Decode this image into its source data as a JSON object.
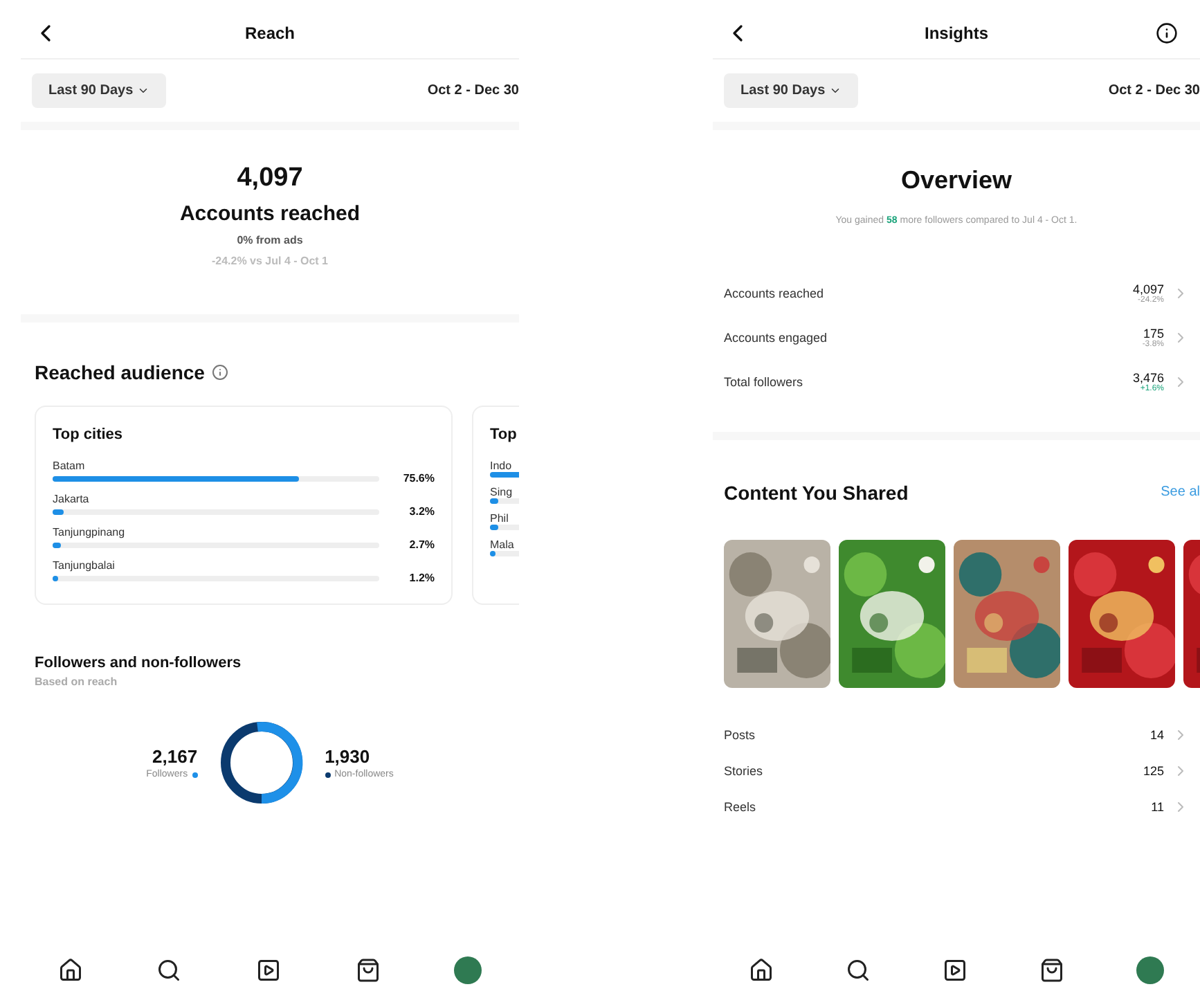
{
  "reach_screen": {
    "title": "Reach",
    "range": {
      "label": "Last 90 Days",
      "dates": "Oct 2 - Dec 30"
    },
    "summary": {
      "value": "4,097",
      "label": "Accounts reached",
      "ads": "0% from ads",
      "compare": "-24.2% vs Jul 4 - Oct 1"
    },
    "audience": {
      "title": "Reached audience",
      "cards": [
        {
          "title": "Top cities",
          "rows": [
            {
              "label": "Batam",
              "level": 0.756,
              "value": "75.6%"
            },
            {
              "label": "Jakarta",
              "level": 0.032,
              "value": "3.2%"
            },
            {
              "label": "Tanjungpinang",
              "level": 0.027,
              "value": "2.7%"
            },
            {
              "label": "Tanjungbalai",
              "level": 0.012,
              "value": "1.2%"
            }
          ]
        },
        {
          "title": "Top",
          "rows": [
            {
              "label": "Indo",
              "level": 0.9
            },
            {
              "label": "Sing",
              "level": 0.02
            },
            {
              "label": "Phil",
              "level": 0.02
            },
            {
              "label": "Mala",
              "level": 0.01
            }
          ]
        }
      ]
    },
    "followers": {
      "title": "Followers and non-followers",
      "subtitle": "Based on reach",
      "left": {
        "value": "2,167",
        "label": "Followers",
        "color": "#1e90e8"
      },
      "right": {
        "value": "1,930",
        "label": "Non-followers",
        "color": "#0b3a6e"
      }
    }
  },
  "insights_screen": {
    "title": "Insights",
    "range": {
      "label": "Last 90 Days",
      "dates": "Oct 2 - Dec 30"
    },
    "overview": {
      "title": "Overview",
      "note": "You gained **58** more followers compared to Jul 4 - Oct 1.",
      "rows": [
        {
          "label": "Accounts reached",
          "value": "4,097",
          "change": "-24.2%",
          "color": "#999999"
        },
        {
          "label": "Accounts engaged",
          "value": "175",
          "change": "-3.8%",
          "color": "#999999"
        },
        {
          "label": "Total followers",
          "value": "3,476",
          "change": "+1.6%",
          "color": "#1aa37a"
        }
      ]
    },
    "content": {
      "title": "Content You Shared",
      "link": "See al",
      "rows": [
        {
          "label": "Posts",
          "value": "14"
        },
        {
          "label": "Stories",
          "value": "125"
        },
        {
          "label": "Reels",
          "value": "11"
        }
      ]
    }
  }
}
